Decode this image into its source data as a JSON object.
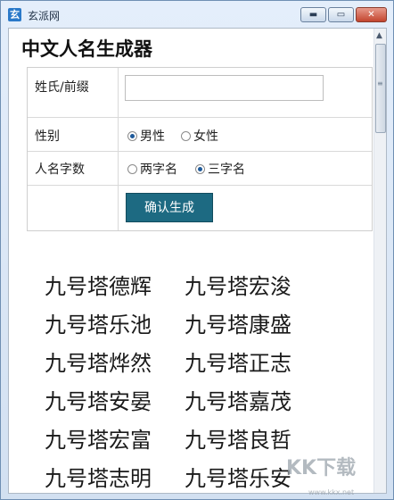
{
  "window": {
    "title": "玄派网",
    "app_icon": "玄",
    "min_glyph": "▬",
    "max_glyph": "▭",
    "close_glyph": "✕"
  },
  "page": {
    "title": "中文人名生成器"
  },
  "form": {
    "surname_label": "姓氏/前缀",
    "surname_value": "",
    "gender_label": "性别",
    "gender_options": [
      {
        "label": "男性",
        "checked": true
      },
      {
        "label": "女性",
        "checked": false
      }
    ],
    "length_label": "人名字数",
    "length_options": [
      {
        "label": "两字名",
        "checked": false
      },
      {
        "label": "三字名",
        "checked": true
      }
    ],
    "generate_label": "确认生成"
  },
  "results": [
    [
      "九号塔德辉",
      "九号塔宏浚"
    ],
    [
      "九号塔乐池",
      "九号塔康盛"
    ],
    [
      "九号塔烨然",
      "九号塔正志"
    ],
    [
      "九号塔安晏",
      "九号塔嘉茂"
    ],
    [
      "九号塔宏富",
      "九号塔良哲"
    ],
    [
      "九号塔志明",
      "九号塔乐安"
    ]
  ],
  "watermark": {
    "text": "KK下载",
    "url": "www.kkx.net"
  },
  "colors": {
    "button": "#1d6a82",
    "radio_checked": "#1e5a9a",
    "close_button": "#c3452f"
  }
}
